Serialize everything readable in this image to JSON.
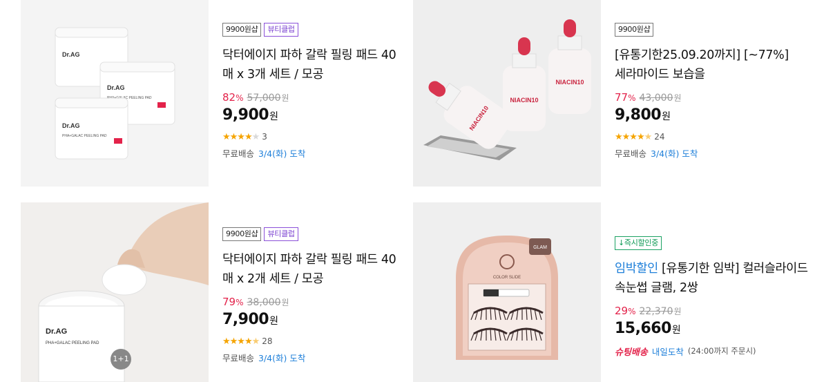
{
  "products": [
    {
      "badges": [
        "9900원샵",
        "뷰티클럽"
      ],
      "title": "닥터에이지 파하 갈락 필링 패드 40매 x 3개 세트 / 모공",
      "discount_pct": "82",
      "pct_unit": "%",
      "original_price": "57,000",
      "original_unit": "원",
      "price": "9,900",
      "price_unit": "원",
      "rating": 4.0,
      "review_count": "3",
      "shipping_label": "무료배송",
      "shipping_date": "3/4(화) 도착",
      "image_label_brand": "Dr.AG",
      "image_label_product": "PHA+GALAC PEELING PAD"
    },
    {
      "badges": [
        "9900원샵"
      ],
      "title": "[유통기한25.09.20까지] [~77%] 세라마이드 보습을",
      "discount_pct": "77",
      "pct_unit": "%",
      "original_price": "43,000",
      "original_unit": "원",
      "price": "9,800",
      "price_unit": "원",
      "rating": 4.5,
      "review_count": "24",
      "shipping_label": "무료배송",
      "shipping_date": "3/4(화) 도착",
      "image_label_product": "NIACIN10"
    },
    {
      "badges": [
        "9900원샵",
        "뷰티클럽"
      ],
      "title": "닥터에이지 파하 갈락 필링 패드 40매 x 2개 세트 / 모공",
      "discount_pct": "79",
      "pct_unit": "%",
      "original_price": "38,000",
      "original_unit": "원",
      "price": "7,900",
      "price_unit": "원",
      "rating": 4.5,
      "review_count": "28",
      "shipping_label": "무료배송",
      "shipping_date": "3/4(화) 도착",
      "image_overlay": "1+1",
      "image_label_brand": "Dr.AG",
      "image_label_product": "PHA+GALAC PEELING PAD"
    },
    {
      "badges": [
        "↓즉시할인중"
      ],
      "title_highlight": "임박할인",
      "title": " [유통기한 임박] 컬러슬라이드 속눈썹 글램, 2쌍",
      "discount_pct": "29",
      "pct_unit": "%",
      "original_price": "22,370",
      "original_unit": "원",
      "price": "15,660",
      "price_unit": "원",
      "rocket_label": "슈팅배송",
      "shipping_date": "내일도착",
      "shipping_note": "(24:00까지 주문시)",
      "image_label_brand": "COLOR SLIDE",
      "image_label_product": "GLAM"
    }
  ],
  "colors": {
    "discount": "#e3224a",
    "link_blue": "#1e7fd9",
    "star": "#f5a400",
    "beauty_badge": "#7a3fd0",
    "instant_badge": "#0f9a55"
  }
}
